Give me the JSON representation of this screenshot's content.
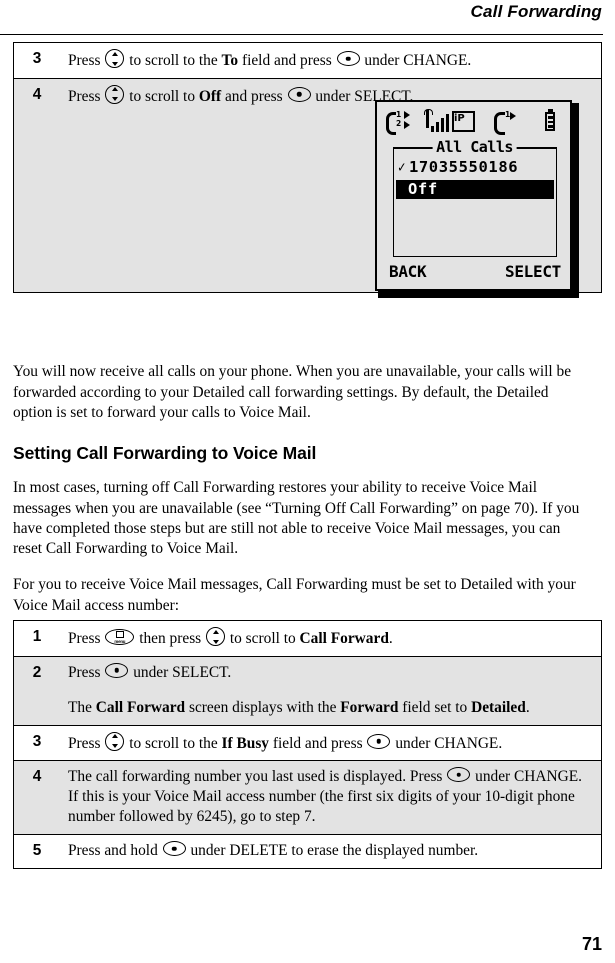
{
  "header": {
    "title": "Call Forwarding"
  },
  "top_table": {
    "rows": [
      {
        "number": "3",
        "shaded": false,
        "text_parts": [
          {
            "t": "Press "
          },
          {
            "icon": "nav-key-icon"
          },
          {
            "t": " to scroll to the "
          },
          {
            "b": "To"
          },
          {
            "t": " field and press "
          },
          {
            "icon": "soft-key-icon"
          },
          {
            "t": " under CHANGE."
          }
        ]
      },
      {
        "number": "4",
        "shaded": true,
        "text_parts": [
          {
            "t": "Press "
          },
          {
            "icon": "nav-key-icon"
          },
          {
            "t": " to scroll to "
          },
          {
            "b": "Off"
          },
          {
            "t": " and press "
          },
          {
            "icon": "soft-key-icon"
          },
          {
            "t": " under SELECT."
          }
        ]
      }
    ]
  },
  "phone_display": {
    "status_icons": {
      "line_indicator": {
        "line1": "1",
        "line2": "2"
      },
      "signal_label": "iP",
      "active_call_line": "1",
      "battery": "battery-icon"
    },
    "title": "All Calls",
    "list": [
      {
        "label": "17035550186",
        "checked": true,
        "selected": false
      },
      {
        "label": "Off",
        "checked": false,
        "selected": true
      }
    ],
    "softkeys": {
      "left": "BACK",
      "right": "SELECT"
    },
    "check_glyph": "✓"
  },
  "paragraphs": {
    "after_table": "You will now receive all calls on your phone. When you are unavailable, your calls will be forwarded according to your Detailed call forwarding settings. By default, the Detailed option is set to forward your calls to Voice Mail.",
    "section_heading": "Setting Call Forwarding to Voice Mail",
    "intro": "In most cases, turning off Call Forwarding restores your ability to receive Voice Mail messages when you are unavailable (see “Turning Off Call Forwarding” on page 70). If you have completed those steps but are still not able to receive Voice Mail messages, you can reset Call Forwarding to Voice Mail.",
    "lead_in": "For you to receive Voice Mail messages, Call Forwarding must be set to Detailed with your Voice Mail access number:"
  },
  "bottom_table": {
    "rows": [
      {
        "number": "1",
        "shaded": false,
        "text_parts": [
          {
            "t": "Press "
          },
          {
            "icon": "menu-key-icon"
          },
          {
            "t": " then press "
          },
          {
            "icon": "nav-key-icon"
          },
          {
            "t": " to scroll to "
          },
          {
            "b": "Call Forward"
          },
          {
            "t": "."
          }
        ]
      },
      {
        "number": "2",
        "shaded": true,
        "text_parts": [
          {
            "t": "Press "
          },
          {
            "icon": "soft-key-icon"
          },
          {
            "t": " under SELECT."
          },
          {
            "gap": true
          },
          {
            "t": "The "
          },
          {
            "b": "Call Forward"
          },
          {
            "t": " screen displays with the "
          },
          {
            "b": "Forward"
          },
          {
            "t": " field set to "
          },
          {
            "b": "Detailed"
          },
          {
            "t": "."
          }
        ]
      },
      {
        "number": "3",
        "shaded": false,
        "text_parts": [
          {
            "t": "Press "
          },
          {
            "icon": "nav-key-icon"
          },
          {
            "t": " to scroll to the "
          },
          {
            "b": "If Busy"
          },
          {
            "t": " field and press "
          },
          {
            "icon": "soft-key-icon"
          },
          {
            "t": " under CHANGE."
          }
        ]
      },
      {
        "number": "4",
        "shaded": true,
        "text_parts": [
          {
            "t": "The call forwarding number you last used is displayed. Press "
          },
          {
            "icon": "soft-key-icon"
          },
          {
            "t": " under CHANGE. If this is your Voice Mail access number (the first six digits of your 10-digit phone number followed by 6245), go to step 7."
          }
        ]
      },
      {
        "number": "5",
        "shaded": false,
        "text_parts": [
          {
            "t": "Press and hold "
          },
          {
            "icon": "soft-key-icon"
          },
          {
            "t": " under DELETE to erase the displayed number."
          }
        ]
      }
    ]
  },
  "menu_key_label": "menu",
  "page_number": "71"
}
